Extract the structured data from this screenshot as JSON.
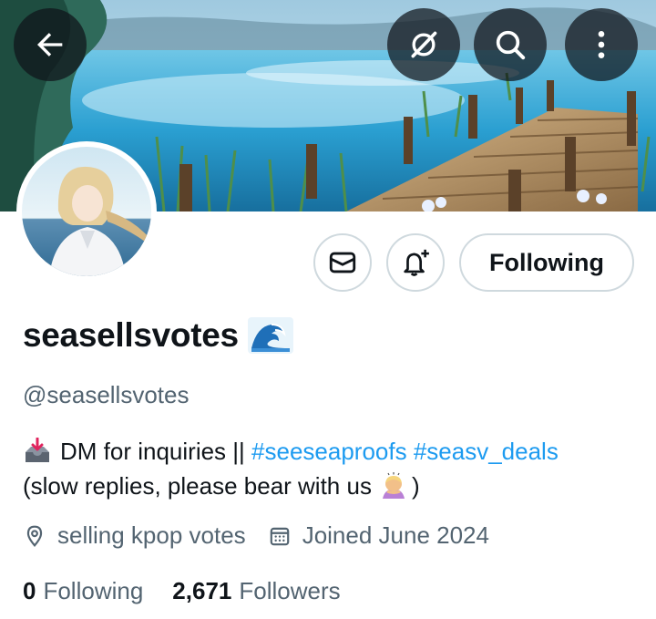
{
  "header": {
    "back_icon": "arrow-left-icon",
    "grok_icon": "grok-icon",
    "search_icon": "search-icon",
    "more_icon": "more-vertical-icon"
  },
  "actions": {
    "message_icon": "mail-icon",
    "notify_icon": "bell-plus-icon",
    "following_label": "Following"
  },
  "profile": {
    "display_name": "seasellsvotes",
    "name_emoji": "water-wave-emoji",
    "handle": "@seasellsvotes",
    "bio": {
      "line1_emoji": "inbox-tray-emoji",
      "line1_text": "DM for inquiries ||",
      "hashtags": [
        "#seeseaproofs",
        "#seasv_deals"
      ],
      "line2_text": "(slow replies, please bear with us",
      "line2_emoji": "person-bowing-emoji",
      "line2_end": ")"
    },
    "location": "selling kpop votes",
    "joined": "Joined June 2024"
  },
  "stats": {
    "following_count": "0",
    "following_label": "Following",
    "followers_count": "2,671",
    "followers_label": "Followers"
  },
  "colors": {
    "accent": "#1d9bf0",
    "text_primary": "#0f1419",
    "text_secondary": "#536471",
    "border": "#cfd9de"
  }
}
